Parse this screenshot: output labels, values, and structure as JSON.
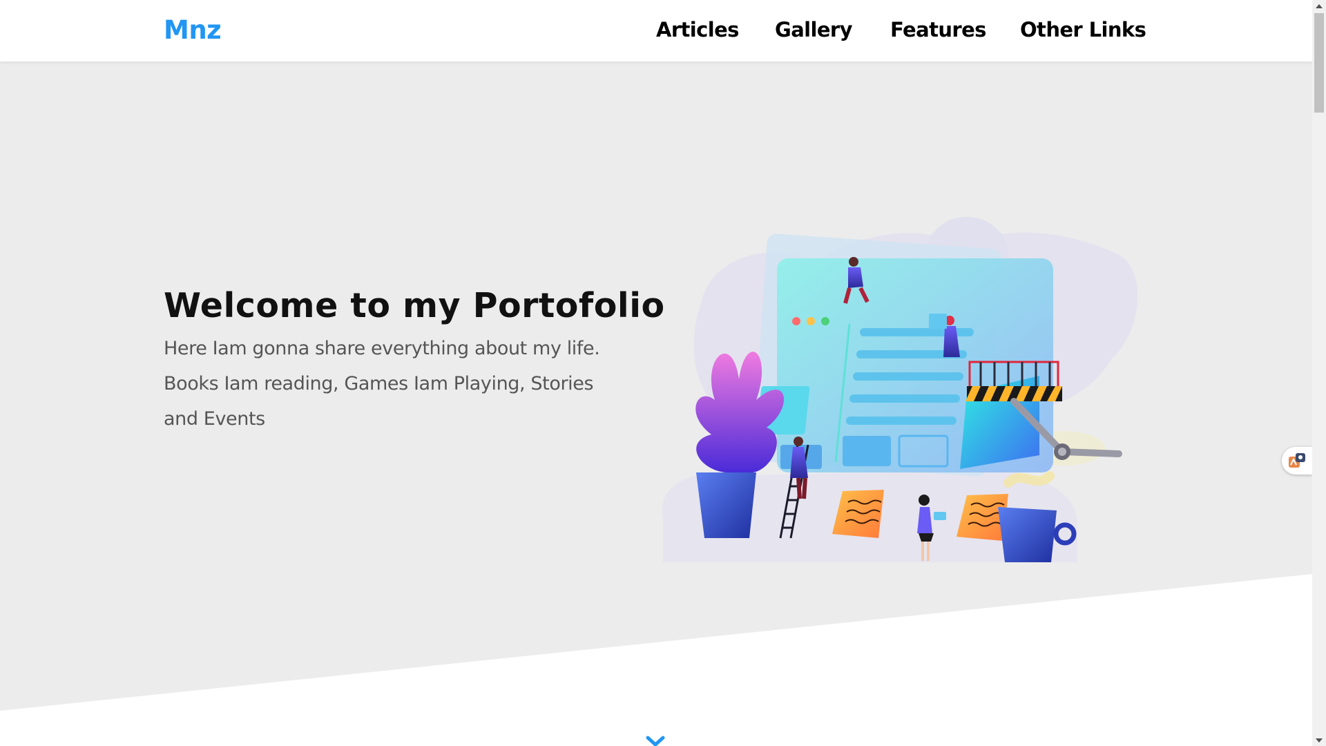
{
  "brand": {
    "logo": "Mnz"
  },
  "nav": {
    "items": [
      {
        "label": "Articles"
      },
      {
        "label": "Gallery"
      },
      {
        "label": "Features"
      },
      {
        "label": "Other Links"
      }
    ]
  },
  "hero": {
    "title": "Welcome to my Portofolio",
    "description": "Here Iam gonna share everything about my life. Books Iam reading, Games Iam Playing, Stories and Events",
    "illustration_icon": "web-development-team-illustration"
  },
  "controls": {
    "scroll_down_icon": "double-chevron-down-icon",
    "side_widget_icon": "chat-translate-icon"
  },
  "colors": {
    "accent": "#2196f3",
    "hero_background": "#ececec",
    "text_dark": "#111111",
    "text_muted": "#555555"
  }
}
